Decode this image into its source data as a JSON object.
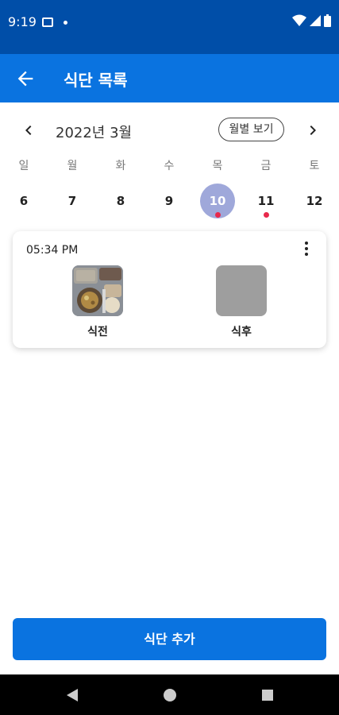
{
  "status": {
    "time": "9:19"
  },
  "appbar": {
    "title": "식단 목록"
  },
  "calendar": {
    "month": "2022년 3월",
    "month_view_label": "월별 보기",
    "days": [
      {
        "weekday": "일",
        "date": "6",
        "selected": false,
        "has_entry": false
      },
      {
        "weekday": "월",
        "date": "7",
        "selected": false,
        "has_entry": false
      },
      {
        "weekday": "화",
        "date": "8",
        "selected": false,
        "has_entry": false
      },
      {
        "weekday": "수",
        "date": "9",
        "selected": false,
        "has_entry": false
      },
      {
        "weekday": "목",
        "date": "10",
        "selected": true,
        "has_entry": true
      },
      {
        "weekday": "금",
        "date": "11",
        "selected": false,
        "has_entry": true
      },
      {
        "weekday": "토",
        "date": "12",
        "selected": false,
        "has_entry": false
      }
    ]
  },
  "meal_card": {
    "time": "05:34 PM",
    "before_label": "식전",
    "after_label": "식후"
  },
  "add_button": {
    "label": "식단 추가"
  },
  "colors": {
    "accent": "#0A73E0",
    "status_bar": "#004EA8",
    "selected_day": "#9FA8DA",
    "entry_dot": "#E8294C"
  },
  "icons": [
    "back-arrow-icon",
    "chevron-left-icon",
    "chevron-right-icon",
    "more-vert-icon",
    "wifi-icon",
    "signal-icon",
    "battery-icon"
  ]
}
